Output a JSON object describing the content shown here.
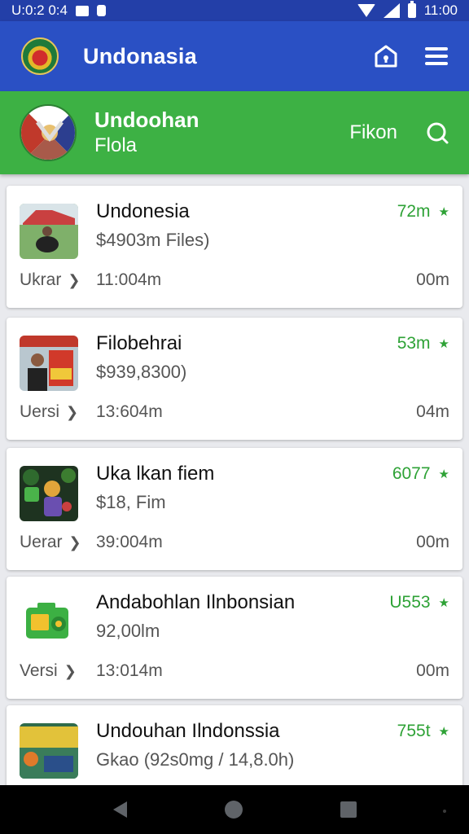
{
  "status_bar": {
    "time_left": "U:0:2 0:4",
    "time_right": "11:00",
    "icons": [
      "message-icon",
      "lock-icon",
      "wifi-icon",
      "signal-icon",
      "battery-icon"
    ]
  },
  "app_bar": {
    "title": "Undonasia",
    "actions": [
      "home-lock-icon",
      "menu-icon"
    ],
    "bg_color": "#2a50c4"
  },
  "banner": {
    "title": "Undoohan",
    "subtitle": "Flola",
    "action_label": "Fikon",
    "bg_color": "#3db144"
  },
  "items": [
    {
      "title": "Undonesia",
      "subtitle": "$4903m Files)",
      "stat": "72m",
      "label": "Ukrar",
      "time": "11:004m",
      "right": "00m"
    },
    {
      "title": "Filobehrai",
      "subtitle": "$939,8300)",
      "stat": "53m",
      "label": "Uersi",
      "time": "13:604m",
      "right": "04m"
    },
    {
      "title": "Uka lkan fiem",
      "subtitle": "$18, Fim",
      "stat": "6077",
      "label": "Uerar",
      "time": "39:004m",
      "right": "00m"
    },
    {
      "title": "Andabohlan Ilnbonsian",
      "subtitle": "92,00lm",
      "stat": "U553",
      "label": "Versi",
      "time": "13:014m",
      "right": "00m"
    },
    {
      "title": "Undouhan Ilndonssia",
      "subtitle": "Gkao (92s0mg / 14,8.0h)",
      "stat": "755t",
      "label": "",
      "time": "",
      "right": ""
    }
  ],
  "nav_bar": {
    "buttons": [
      "back",
      "home",
      "recents"
    ]
  }
}
